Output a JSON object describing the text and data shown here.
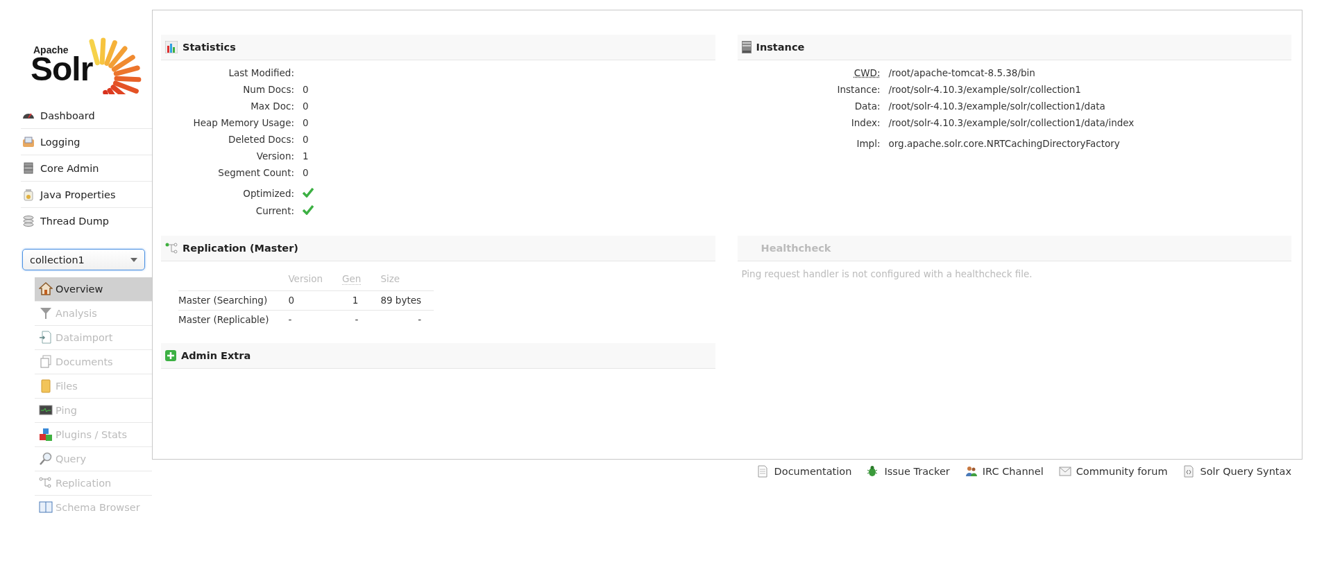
{
  "logo": {
    "small": "Apache",
    "big": "Solr"
  },
  "nav": [
    {
      "label": "Dashboard"
    },
    {
      "label": "Logging"
    },
    {
      "label": "Core Admin"
    },
    {
      "label": "Java Properties"
    },
    {
      "label": "Thread Dump"
    }
  ],
  "core_selector": {
    "value": "collection1"
  },
  "core_menu": [
    {
      "label": "Overview",
      "selected": true,
      "disabled": false
    },
    {
      "label": "Analysis",
      "selected": false,
      "disabled": true
    },
    {
      "label": "Dataimport",
      "selected": false,
      "disabled": true
    },
    {
      "label": "Documents",
      "selected": false,
      "disabled": true
    },
    {
      "label": "Files",
      "selected": false,
      "disabled": true
    },
    {
      "label": "Ping",
      "selected": false,
      "disabled": true
    },
    {
      "label": "Plugins / Stats",
      "selected": false,
      "disabled": true
    },
    {
      "label": "Query",
      "selected": false,
      "disabled": true
    },
    {
      "label": "Replication",
      "selected": false,
      "disabled": true
    },
    {
      "label": "Schema Browser",
      "selected": false,
      "disabled": true
    }
  ],
  "statistics": {
    "title": "Statistics",
    "rows": [
      {
        "label": "Last Modified:",
        "value": ""
      },
      {
        "label": "Num Docs:",
        "value": "0"
      },
      {
        "label": "Max Doc:",
        "value": "0"
      },
      {
        "label": "Heap Memory Usage:",
        "value": "0"
      },
      {
        "label": "Deleted Docs:",
        "value": "0"
      },
      {
        "label": "Version:",
        "value": "1"
      },
      {
        "label": "Segment Count:",
        "value": "0"
      }
    ],
    "flags": [
      {
        "label": "Optimized:",
        "checked": true
      },
      {
        "label": "Current:",
        "checked": true
      }
    ]
  },
  "replication": {
    "title": "Replication (Master)",
    "columns": [
      {
        "label": "Version",
        "abbreviation": false
      },
      {
        "label": "Gen",
        "abbreviation": true
      },
      {
        "label": "Size",
        "abbreviation": false
      }
    ],
    "rows": [
      {
        "label": "Master (Searching)",
        "cells": [
          "0",
          "1",
          "89 bytes"
        ]
      },
      {
        "label": "Master (Replicable)",
        "cells": [
          "-",
          "-",
          "-"
        ]
      }
    ]
  },
  "admin_extra": {
    "title": "Admin Extra"
  },
  "instance": {
    "title": "Instance",
    "rows": [
      {
        "label": "CWD:",
        "abbreviation": true,
        "value": "/root/apache-tomcat-8.5.38/bin"
      },
      {
        "label": "Instance:",
        "abbreviation": false,
        "value": "/root/solr-4.10.3/example/solr/collection1"
      },
      {
        "label": "Data:",
        "abbreviation": false,
        "value": "/root/solr-4.10.3/example/solr/collection1/data"
      },
      {
        "label": "Index:",
        "abbreviation": false,
        "value": "/root/solr-4.10.3/example/solr/collection1/data/index"
      }
    ],
    "impl": {
      "label": "Impl:",
      "value": "org.apache.solr.core.NRTCachingDirectoryFactory"
    }
  },
  "healthcheck": {
    "title": "Healthcheck",
    "disabled": true,
    "message": "Ping request handler is not configured with a healthcheck file."
  },
  "footer_links": [
    {
      "label": "Documentation"
    },
    {
      "label": "Issue Tracker"
    },
    {
      "label": "IRC Channel"
    },
    {
      "label": "Community forum"
    },
    {
      "label": "Solr Query Syntax"
    }
  ]
}
